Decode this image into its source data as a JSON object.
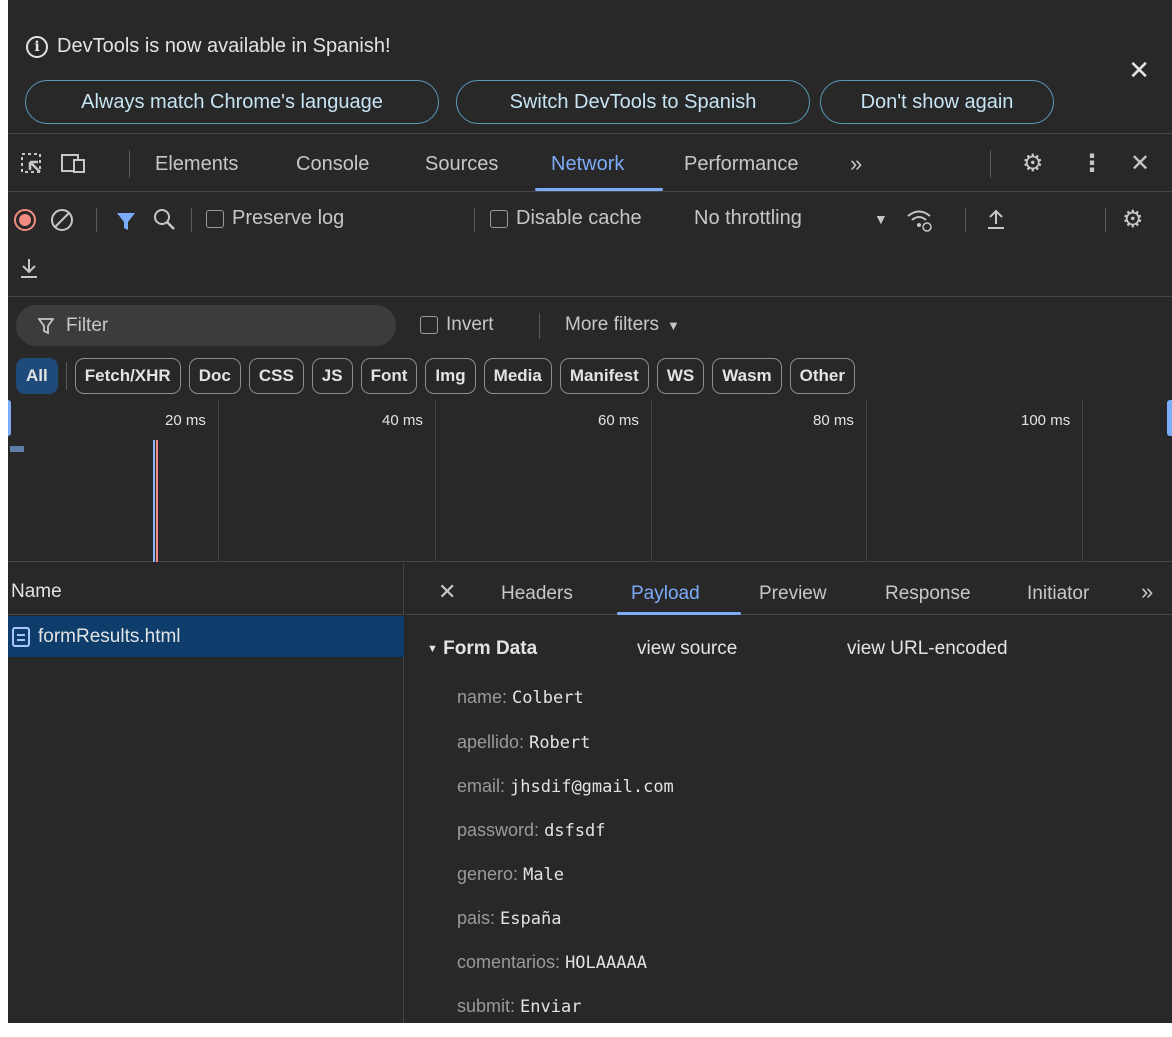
{
  "infobar": {
    "message": "DevTools is now available in Spanish!",
    "buttons": [
      "Always match Chrome's language",
      "Switch DevTools to Spanish",
      "Don't show again"
    ]
  },
  "tabs": [
    "Elements",
    "Console",
    "Sources",
    "Network",
    "Performance"
  ],
  "active_tab": "Network",
  "network_toolbar": {
    "preserve_log": "Preserve log",
    "disable_cache": "Disable cache",
    "throttling": "No throttling"
  },
  "filter": {
    "placeholder": "Filter",
    "invert": "Invert",
    "more_filters": "More filters"
  },
  "type_chips": [
    "All",
    "Fetch/XHR",
    "Doc",
    "CSS",
    "JS",
    "Font",
    "Img",
    "Media",
    "Manifest",
    "WS",
    "Wasm",
    "Other"
  ],
  "timeline_labels": [
    "20 ms",
    "40 ms",
    "60 ms",
    "80 ms",
    "100 ms"
  ],
  "requests": {
    "column_name": "Name",
    "rows": [
      "formResults.html"
    ]
  },
  "detail_tabs": [
    "Headers",
    "Payload",
    "Preview",
    "Response",
    "Initiator"
  ],
  "active_detail_tab": "Payload",
  "payload": {
    "section_title": "Form Data",
    "view_source": "view source",
    "view_url_encoded": "view URL-encoded",
    "fields": [
      {
        "key": "name:",
        "value": "Colbert"
      },
      {
        "key": "apellido:",
        "value": "Robert"
      },
      {
        "key": "email:",
        "value": "jhsdif@gmail.com"
      },
      {
        "key": "password:",
        "value": "dsfsdf"
      },
      {
        "key": "genero:",
        "value": "Male"
      },
      {
        "key": "pais:",
        "value": "España"
      },
      {
        "key": "comentarios:",
        "value": "HOLAAAAA"
      },
      {
        "key": "submit:",
        "value": "Enviar"
      }
    ]
  },
  "colors": {
    "background": "#282828",
    "accent": "#7cacf8",
    "selected_row": "#0e3d6c",
    "record": "#f28b82"
  }
}
